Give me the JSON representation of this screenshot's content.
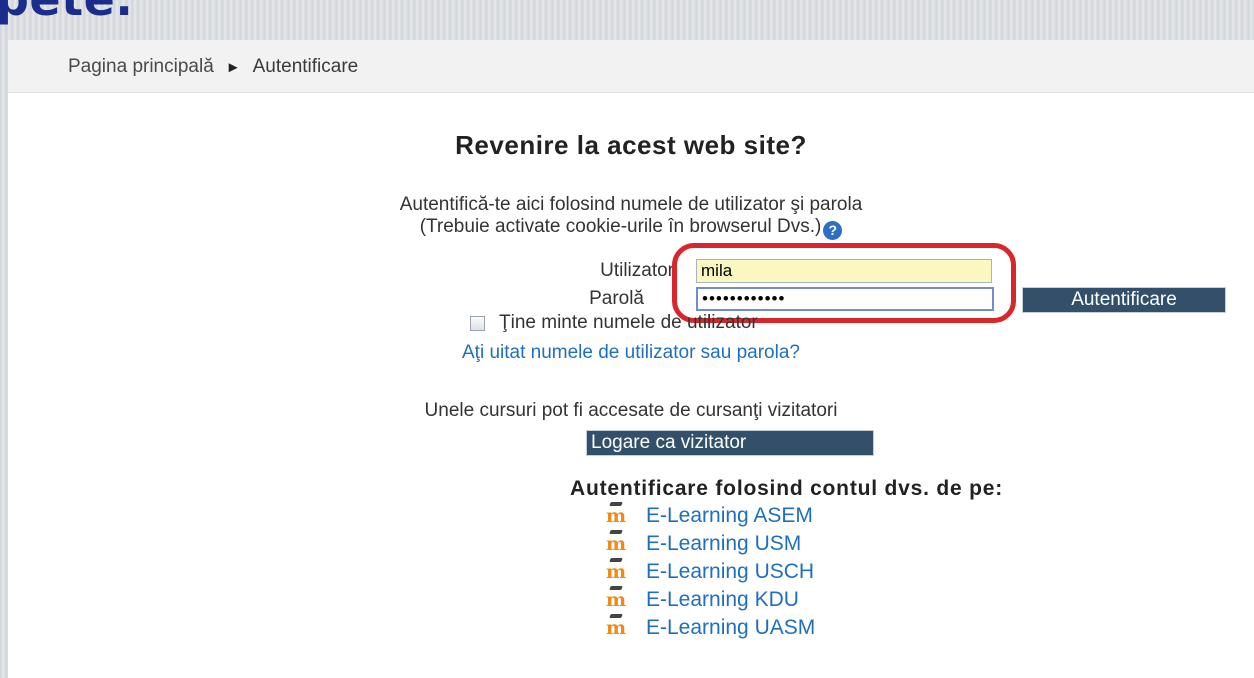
{
  "slide": {
    "title_fragment": "pete."
  },
  "breadcrumb": {
    "home": "Pagina principală",
    "separator": "►",
    "current": "Autentificare"
  },
  "login": {
    "heading": "Revenire la acest web site?",
    "description_line1": "Autentifică-te aici folosind numele de utilizator şi parola",
    "description_line2": "(Trebuie activate cookie-urile în browserul Dvs.)",
    "help_icon": "?",
    "username_label": "Utilizator",
    "username_value": "mila",
    "password_label": "Parolă",
    "password_value": "••••••••••••",
    "submit_label": "Autentificare",
    "remember_label": "Ţine minte numele de utilizator",
    "forgot_link": "Aţi uitat numele de utilizator sau parola?"
  },
  "guest": {
    "note": "Unele cursuri pot fi accesate de cursanţi vizitatori",
    "button_label": "Logare ca vizitator"
  },
  "alternate": {
    "heading": "Autentificare folosind contul dvs. de pe:",
    "icon_glyph": "m",
    "providers": [
      {
        "label": "E-Learning ASEM"
      },
      {
        "label": "E-Learning USM"
      },
      {
        "label": "E-Learning USCH"
      },
      {
        "label": "E-Learning KDU"
      },
      {
        "label": "E-Learning UASM"
      }
    ]
  },
  "colors": {
    "title": "#1b2d8c",
    "highlight": "#d9262d",
    "link": "#1f6fbf",
    "button_bg": "#33506b",
    "username_bg": "#fbf7c0",
    "moodle_icon": "#f08a10"
  }
}
